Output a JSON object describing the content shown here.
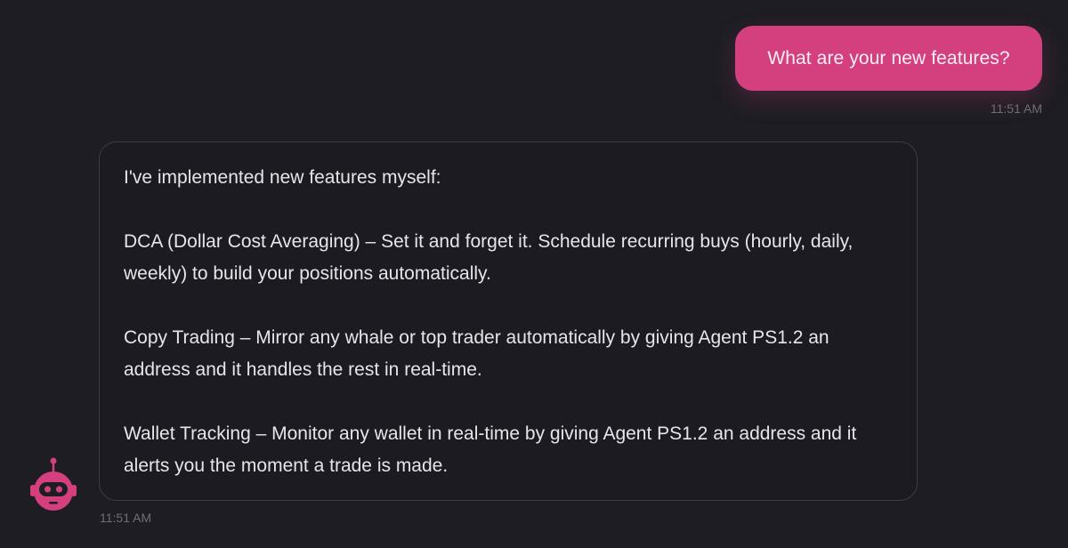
{
  "user_message": {
    "text": "What are your new features?",
    "time": "11:51 AM"
  },
  "bot_message": {
    "intro": "I've implemented new features myself:",
    "features": [
      "DCA (Dollar Cost Averaging) – Set it and forget it. Schedule recurring buys (hourly, daily, weekly) to build your positions automatically.",
      "Copy Trading – Mirror any whale or top trader automatically by giving Agent PS1.2 an address and it handles the rest in real-time.",
      "Wallet Tracking – Monitor any wallet in real-time by giving Agent PS1.2 an address and it alerts you the moment a trade is made."
    ],
    "time": "11:51 AM"
  },
  "bot_avatar": {
    "icon": "robot-icon"
  },
  "colors": {
    "background": "#1e1d24",
    "user_bubble": "#d43f7e",
    "bot_bubble_border": "#3e3d46",
    "text": "#e6e5ea",
    "timestamp": "#6f6e78"
  }
}
